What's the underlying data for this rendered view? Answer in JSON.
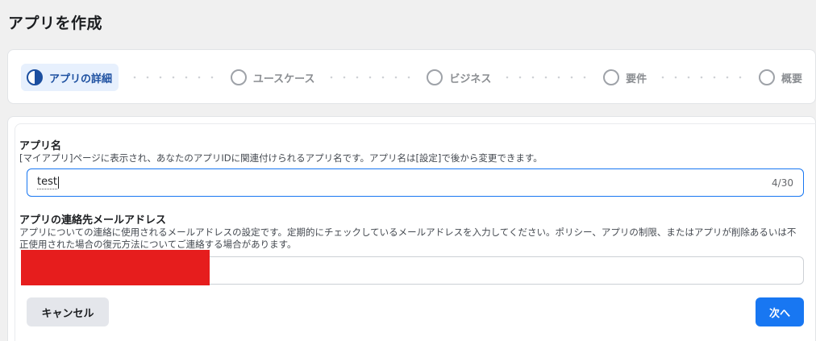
{
  "page": {
    "title": "アプリを作成"
  },
  "stepper": {
    "steps": [
      {
        "label": "アプリの詳細",
        "state": "active"
      },
      {
        "label": "ユースケース",
        "state": "pending"
      },
      {
        "label": "ビジネス",
        "state": "pending"
      },
      {
        "label": "要件",
        "state": "pending"
      },
      {
        "label": "概要",
        "state": "pending"
      }
    ]
  },
  "form": {
    "app_name": {
      "label": "アプリ名",
      "description": "[マイアプリ]ページに表示され、あなたのアプリIDに関連付けられるアプリ名です。アプリ名は[設定]で後から変更できます。",
      "value": "test",
      "char_count": "4/30"
    },
    "contact_email": {
      "label": "アプリの連絡先メールアドレス",
      "description": "アプリについての連絡に使用されるメールアドレスの設定です。定期的にチェックしているメールアドレスを入力してください。ポリシー、アプリの制限、またはアプリが削除あるいは不正使用された場合の復元方法についてご連絡する場合があります。",
      "value": ""
    }
  },
  "actions": {
    "cancel_label": "キャンセル",
    "next_label": "次へ"
  },
  "colors": {
    "primary": "#1877f2",
    "active_step_bg": "#e7f0fd",
    "active_step_text": "#1c4fa0",
    "redaction": "#e61d1d"
  }
}
